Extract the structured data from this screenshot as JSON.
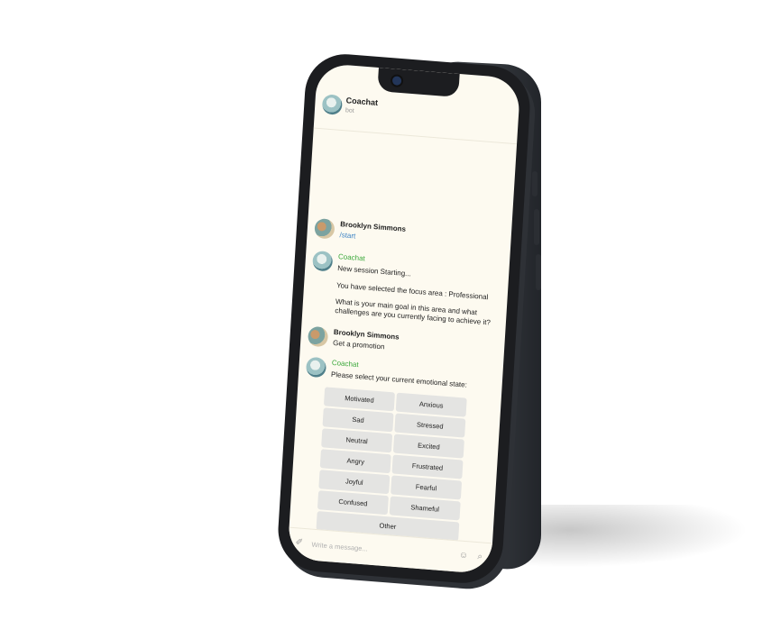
{
  "header": {
    "title": "Coachat",
    "subtitle": "bot"
  },
  "messages": [
    {
      "sender": "Brooklyn Simmons",
      "role": "user",
      "lines": [
        "/start"
      ]
    },
    {
      "sender": "Coachat",
      "role": "bot",
      "lines": [
        "New session Starting...",
        "You have selected the focus area : Professional",
        "What is your main goal in this area and what",
        "challenges are you currently facing to achieve it?"
      ]
    },
    {
      "sender": "Brooklyn Simmons",
      "role": "user",
      "lines": [
        "Get a promotion"
      ]
    },
    {
      "sender": "Coachat",
      "role": "bot",
      "lines": [
        "Please select your current emotional state:"
      ]
    }
  ],
  "keyboard": {
    "rows": [
      [
        "Motivated",
        "Anxious"
      ],
      [
        "Sad",
        "Stressed"
      ],
      [
        "Neutral",
        "Excited"
      ],
      [
        "Angry",
        "Frustrated"
      ],
      [
        "Joyful",
        "Fearful"
      ],
      [
        "Confused",
        "Shameful"
      ],
      [
        "Other"
      ]
    ]
  },
  "composer": {
    "placeholder": "Write a message..."
  },
  "icons": [
    "attach-icon",
    "emoji-icon",
    "microphone-icon"
  ]
}
